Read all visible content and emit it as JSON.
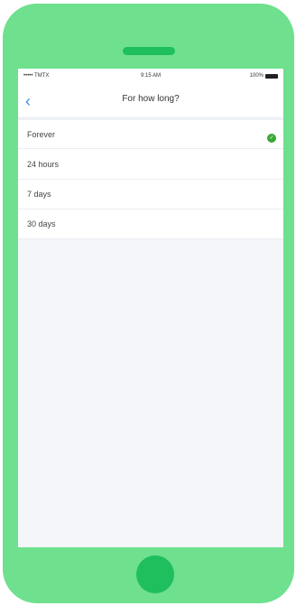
{
  "status": {
    "carrier": "••••• TMTX",
    "time": "9:15 AM",
    "battery": "100%"
  },
  "nav": {
    "title": "For how long?",
    "back_icon": "chevron-left-icon"
  },
  "options": [
    {
      "label": "Forever",
      "selected": true
    },
    {
      "label": "24 hours",
      "selected": false
    },
    {
      "label": "7 days",
      "selected": false
    },
    {
      "label": "30 days",
      "selected": false
    }
  ],
  "colors": {
    "device": "#6ee08e",
    "device_dark": "#1fbf5e",
    "accent": "#3a8ee6",
    "check": "#3aa832"
  }
}
